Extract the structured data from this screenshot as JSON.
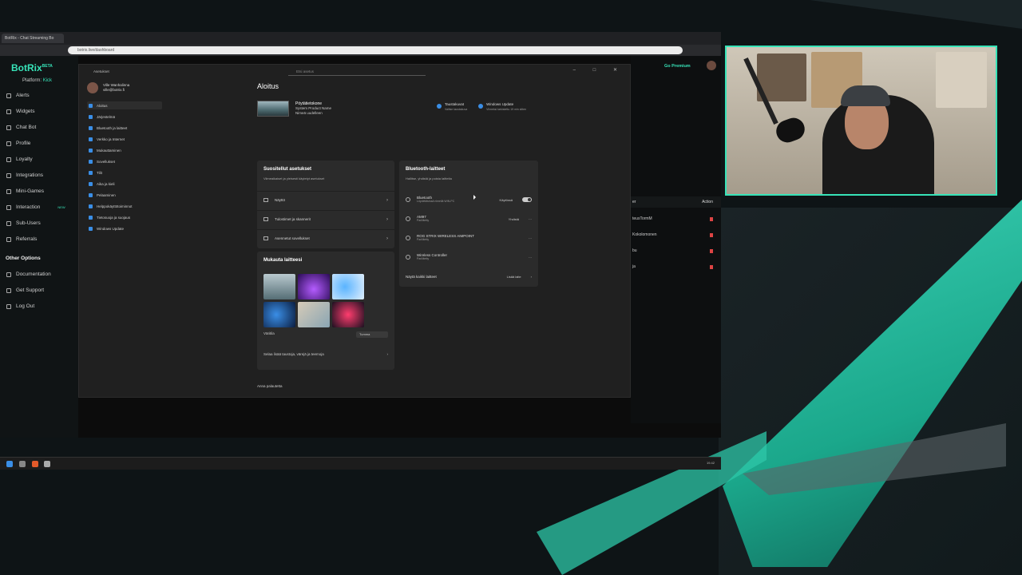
{
  "browser": {
    "tab_label": "BotRix - Chat Streaming Bo",
    "url": "botrix.live/dashboard"
  },
  "botrix": {
    "brand": "BotRix",
    "brand_sup": "BETA",
    "platform_label": "Platform:",
    "platform_value": "Kick",
    "nav": [
      {
        "label": "Alerts"
      },
      {
        "label": "Widgets"
      },
      {
        "label": "Chat Bot"
      },
      {
        "label": "Profile"
      },
      {
        "label": "Loyalty"
      },
      {
        "label": "Integrations"
      },
      {
        "label": "Mini-Games"
      },
      {
        "label": "Interaction",
        "badge": "NEW"
      },
      {
        "label": "Sub-Users"
      },
      {
        "label": "Referrals"
      }
    ],
    "other_section": "Other Options",
    "other": [
      {
        "label": "Documentation"
      },
      {
        "label": "Get Support"
      },
      {
        "label": "Log Out"
      }
    ],
    "go_premium": "Go Premium",
    "table_header_left": "er",
    "table_header_action": "Action",
    "table_rows": [
      {
        "text": "teusTormM"
      },
      {
        "text": "Kokolomonen"
      },
      {
        "text": "bu"
      },
      {
        "text": "ja"
      }
    ]
  },
  "settings": {
    "window_title": "Asetukset",
    "search_placeholder": "Etsi asetus",
    "user_name": "Ville Wanhalinna",
    "user_email": "ville@botrix.fi",
    "nav": [
      {
        "label": "Aloitus",
        "active": true
      },
      {
        "label": "Järjestelmä"
      },
      {
        "label": "Bluetooth ja laitteet"
      },
      {
        "label": "Verkko ja Internet"
      },
      {
        "label": "Mukauttaminen"
      },
      {
        "label": "Sovellukset"
      },
      {
        "label": "Tilit"
      },
      {
        "label": "Aika ja kieli"
      },
      {
        "label": "Pelaaminen"
      },
      {
        "label": "Helppokäyttötoiminnot"
      },
      {
        "label": "Tietosuoja ja suojaus"
      },
      {
        "label": "Windows Update"
      }
    ],
    "page_title": "Aloitus",
    "device_name": "Pöytätietokone",
    "device_sub1": "System Product Name",
    "device_sub2": "Nimeä uudelleen",
    "quick_links": [
      {
        "label": "Taustakuvat",
        "sub": "Valitse taustakuva"
      },
      {
        "label": "Windows Update",
        "sub": "Viimeksi tarkistettu 19 min sitten"
      }
    ],
    "recommended": {
      "title": "Suositellut asetukset",
      "sub": "Viimeaikaiset ja yleisesti käytetyt asetukset",
      "rows": [
        {
          "label": "Näyttö"
        },
        {
          "label": "Tulostimet ja skannerit"
        },
        {
          "label": "Asennetut sovellukset"
        }
      ]
    },
    "personalize": {
      "title": "Mukauta laitteesi",
      "theme_label": "Väritila",
      "theme_value": "Tumma",
      "more_link": "Selaa lisää taustoja, värejä ja teemoja"
    },
    "bluetooth": {
      "title": "Bluetooth-laitteet",
      "sub": "Hallitse, yhdistä ja poista laitteita",
      "rows": [
        {
          "name": "Bluetooth",
          "sub": "Löydettävissä nimellä WIN-PC",
          "action": "Käytössä"
        },
        {
          "name": "AM97",
          "sub": "Pariliitetty",
          "action": "Yhdistä"
        },
        {
          "name": "ROG STRIX WIRELESS AIMPOINT",
          "sub": "Pariliitetty",
          "action": ""
        },
        {
          "name": "Wireless Controller",
          "sub": "Pariliitetty",
          "action": ""
        }
      ],
      "footer_left": "Näytä kaikki laitteet",
      "footer_right": "Lisää laite"
    },
    "feedback": "Anna palautetta"
  },
  "taskbar": {
    "time": "19.42"
  },
  "colors": {
    "accent": "#37e3b8",
    "win_bg": "#202020",
    "card_bg": "#2b2b2b"
  }
}
